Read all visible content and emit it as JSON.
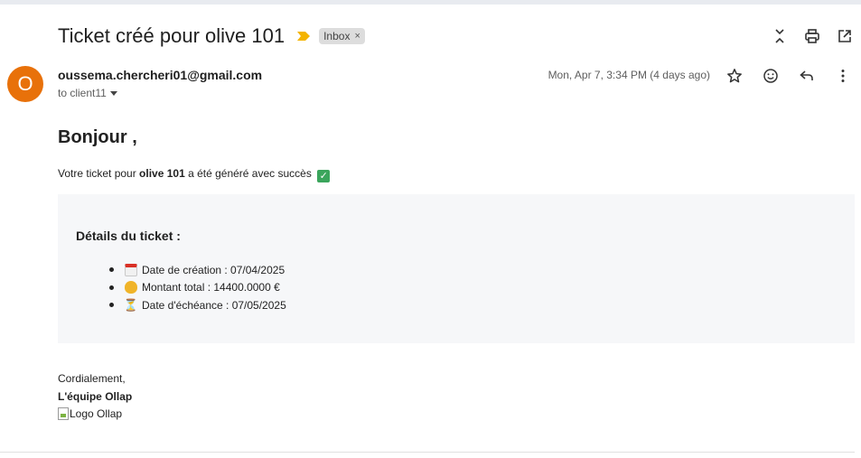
{
  "message": {
    "subject": "Ticket créé pour olive 101",
    "label": "Inbox",
    "label_close": "×",
    "sender_email": "oussema.chercheri01@gmail.com",
    "avatar_letter": "O",
    "to": "to client11",
    "date": "Mon, Apr 7, 3:34 PM (4 days ago)"
  },
  "icons": {
    "top": [
      "collapse-icon",
      "print-icon",
      "open-in-new-window-icon"
    ],
    "message": [
      "star-icon",
      "emoji-icon",
      "reply-icon",
      "more-vert-icon"
    ]
  },
  "body": {
    "greeting": "Bonjour ,",
    "intro_prefix": "Votre ticket pour ",
    "intro_bold": "olive 101",
    "intro_suffix": " a été généré avec succès",
    "details_title": "Détails du ticket :",
    "details": [
      "Date de création : 07/04/2025",
      "Montant total : 14400.0000 €",
      "Date d'échéance : 07/05/2025"
    ],
    "closing": "Cordialement,",
    "team": "L'équipe Ollap",
    "logo_alt": "Logo Ollap"
  },
  "colors": {
    "avatar": "#e8710a",
    "importance": "#f4b400",
    "details_bg": "#f6f7f9"
  }
}
